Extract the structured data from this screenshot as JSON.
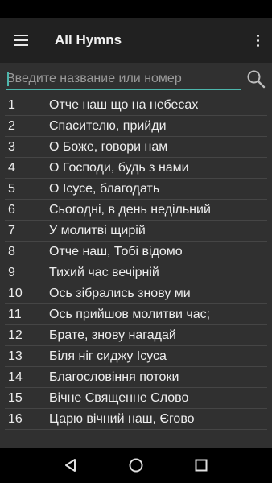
{
  "toolbar": {
    "title": "All Hymns",
    "menu_icon": "hamburger-menu-icon",
    "overflow_icon": "more-vert-icon"
  },
  "search": {
    "placeholder": "Введите название или номер",
    "value": "",
    "icon": "search-icon"
  },
  "hymns": [
    {
      "number": "1",
      "title": "Отче наш що на небесах"
    },
    {
      "number": "2",
      "title": "Спасителю, прийди"
    },
    {
      "number": "3",
      "title": "О Боже, говори нам"
    },
    {
      "number": "4",
      "title": "О Господи, будь з нами"
    },
    {
      "number": "5",
      "title": "О Ісусе, благодать"
    },
    {
      "number": "6",
      "title": "Сьогодні, в день недільний"
    },
    {
      "number": "7",
      "title": "У молитві щирій"
    },
    {
      "number": "8",
      "title": "Отче наш, Тобі відомо"
    },
    {
      "number": "9",
      "title": "Тихий час вечірній"
    },
    {
      "number": "10",
      "title": "Ось зібрались знову ми"
    },
    {
      "number": "11",
      "title": "Ось прийшов молитви час;"
    },
    {
      "number": "12",
      "title": "Брате, знову нагадай"
    },
    {
      "number": "13",
      "title": "Біля ніг сиджу Ісуса"
    },
    {
      "number": "14",
      "title": "Благословіння потоки"
    },
    {
      "number": "15",
      "title": "Вічне Священне Слово"
    },
    {
      "number": "16",
      "title": "Царю вічний наш, Єгово"
    }
  ],
  "navigation": {
    "back_icon": "back-triangle-icon",
    "home_icon": "home-circle-icon",
    "recents_icon": "recents-square-icon"
  },
  "colors": {
    "toolbar": "#212121",
    "background": "#303030",
    "accent": "#4db6ac",
    "text": "#ededed"
  }
}
